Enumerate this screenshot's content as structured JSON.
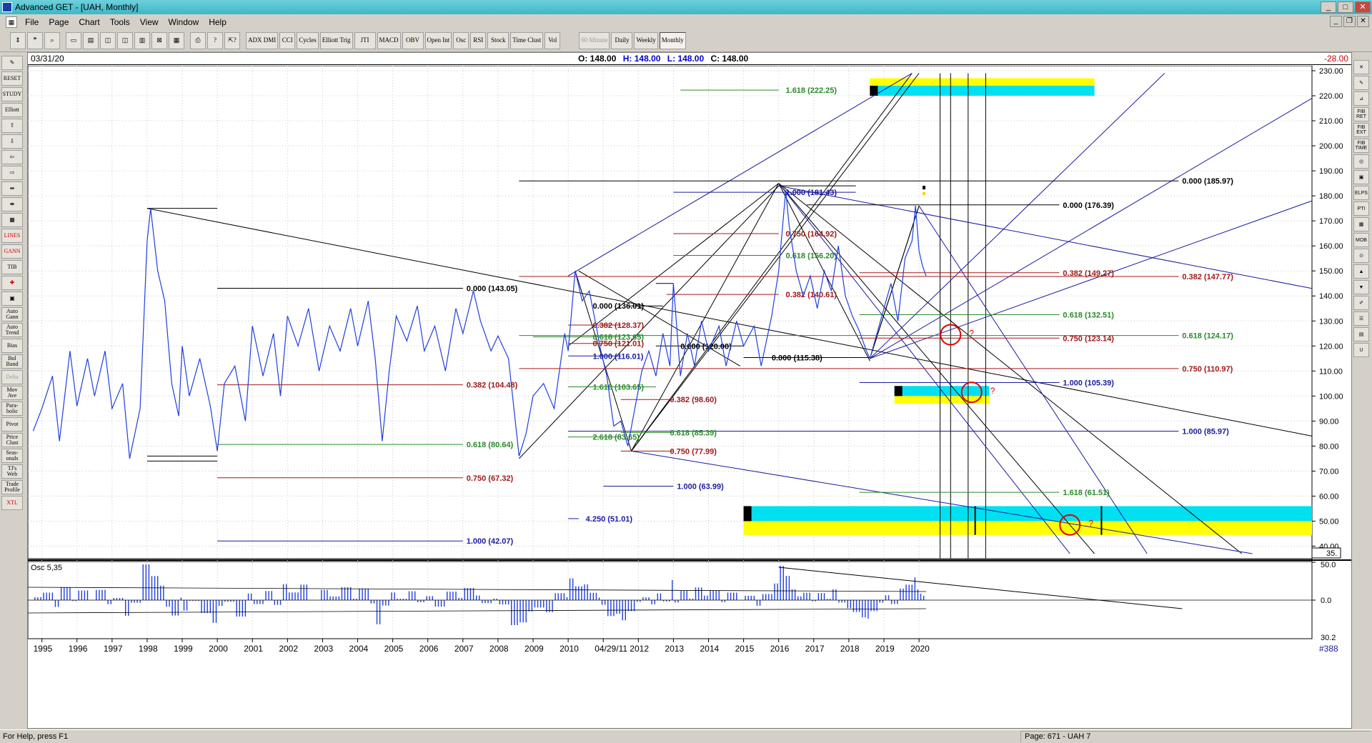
{
  "window": {
    "title": "Advanced GET - [UAH, Monthly]",
    "controls": [
      "_",
      "□",
      "✕"
    ]
  },
  "menu": {
    "items": [
      "File",
      "Page",
      "Chart",
      "Tools",
      "View",
      "Window",
      "Help"
    ]
  },
  "toolbar": {
    "buttons": [
      "ADX DMI",
      "CCI",
      "Cycles",
      "Elliott Trig",
      "JTI",
      "MACD",
      "OBV",
      "Open Int",
      "Osc",
      "RSI",
      "Stock",
      "Time Clust",
      "Vol"
    ],
    "periods": [
      "60 Minute",
      "Daily",
      "Weekly",
      "Monthly"
    ],
    "active_period": "Monthly"
  },
  "left_tools": [
    "RESET",
    "STUDY",
    "Elliott",
    "LINES",
    "GANN",
    "TIB",
    "Auto Gann",
    "Auto Trend",
    "Bias",
    "Bol Band",
    "Delta",
    "Mov Ave",
    "Para-bolic",
    "Pivot",
    "Price Clust",
    "Seas-onals",
    "TJ's Web",
    "Trade Profile",
    "XTL"
  ],
  "right_tools": [
    "FIB RET",
    "FIB EXT",
    "FIB TIME",
    "ELPS",
    "PTI",
    "MOB"
  ],
  "info": {
    "date": "03/31/20",
    "open": "O: 148.00",
    "high": "H: 148.00",
    "low": "L: 148.00",
    "close": "C: 148.00",
    "value": "-28.00"
  },
  "chart_data": {
    "type": "line",
    "symbol": "UAH",
    "timeframe": "Monthly",
    "x_labels": [
      "1995",
      "1996",
      "1997",
      "1998",
      "1999",
      "2000",
      "2001",
      "2002",
      "2003",
      "2004",
      "2005",
      "2006",
      "2007",
      "2008",
      "2009",
      "2010",
      "04/29/11",
      "2012",
      "2013",
      "2014",
      "2015",
      "2016",
      "2017",
      "2018",
      "2019",
      "2020"
    ],
    "y_ticks": [
      40,
      50,
      60,
      70,
      80,
      90,
      100,
      110,
      120,
      130,
      140,
      150,
      160,
      170,
      180,
      190,
      200,
      210,
      220,
      230
    ],
    "y_range": [
      35,
      232
    ],
    "series": [
      {
        "color": "#1f3fe0",
        "points": [
          [
            1994.75,
            86
          ],
          [
            1995.0,
            95
          ],
          [
            1995.3,
            108
          ],
          [
            1995.5,
            82
          ],
          [
            1995.8,
            118
          ],
          [
            1996.0,
            96
          ],
          [
            1996.3,
            115
          ],
          [
            1996.5,
            100
          ],
          [
            1996.8,
            118
          ],
          [
            1997.0,
            95
          ],
          [
            1997.3,
            105
          ],
          [
            1997.5,
            75
          ],
          [
            1997.8,
            95
          ],
          [
            1998.0,
            162
          ],
          [
            1998.1,
            175
          ],
          [
            1998.3,
            150
          ],
          [
            1998.5,
            138
          ],
          [
            1998.7,
            105
          ],
          [
            1998.9,
            92
          ],
          [
            1999.0,
            120
          ],
          [
            1999.2,
            100
          ],
          [
            1999.5,
            115
          ],
          [
            1999.8,
            96
          ],
          [
            2000.0,
            78
          ],
          [
            2000.2,
            105
          ],
          [
            2000.5,
            112
          ],
          [
            2000.8,
            90
          ],
          [
            2001.0,
            128
          ],
          [
            2001.3,
            108
          ],
          [
            2001.6,
            125
          ],
          [
            2001.8,
            100
          ],
          [
            2002.0,
            132
          ],
          [
            2002.3,
            120
          ],
          [
            2002.6,
            135
          ],
          [
            2002.9,
            110
          ],
          [
            2003.2,
            128
          ],
          [
            2003.5,
            118
          ],
          [
            2003.8,
            135
          ],
          [
            2004.0,
            120
          ],
          [
            2004.3,
            138
          ],
          [
            2004.5,
            115
          ],
          [
            2004.7,
            82
          ],
          [
            2004.9,
            110
          ],
          [
            2005.1,
            132
          ],
          [
            2005.4,
            122
          ],
          [
            2005.7,
            136
          ],
          [
            2005.9,
            118
          ],
          [
            2006.2,
            128
          ],
          [
            2006.5,
            110
          ],
          [
            2006.8,
            135
          ],
          [
            2007.0,
            125
          ],
          [
            2007.3,
            142
          ],
          [
            2007.5,
            130
          ],
          [
            2007.8,
            118
          ],
          [
            2008.0,
            124
          ],
          [
            2008.3,
            115
          ],
          [
            2008.6,
            76
          ],
          [
            2008.8,
            85
          ],
          [
            2009.0,
            100
          ],
          [
            2009.3,
            105
          ],
          [
            2009.6,
            95
          ],
          [
            2009.9,
            125
          ],
          [
            2010.0,
            118
          ],
          [
            2010.2,
            150
          ],
          [
            2010.4,
            138
          ],
          [
            2010.6,
            142
          ],
          [
            2010.8,
            128
          ],
          [
            2010.9,
            120
          ],
          [
            2011.1,
            108
          ],
          [
            2011.3,
            88
          ],
          [
            2011.5,
            90
          ],
          [
            2011.7,
            80
          ],
          [
            2011.9,
            95
          ],
          [
            2012.1,
            110
          ],
          [
            2012.3,
            118
          ],
          [
            2012.5,
            108
          ],
          [
            2012.7,
            125
          ],
          [
            2012.9,
            112
          ],
          [
            2013.0,
            145
          ],
          [
            2013.2,
            108
          ],
          [
            2013.4,
            125
          ],
          [
            2013.6,
            112
          ],
          [
            2013.8,
            130
          ],
          [
            2014.0,
            118
          ],
          [
            2014.3,
            128
          ],
          [
            2014.5,
            112
          ],
          [
            2014.8,
            130
          ],
          [
            2015.0,
            120
          ],
          [
            2015.3,
            128
          ],
          [
            2015.5,
            112
          ],
          [
            2015.8,
            132
          ],
          [
            2016.0,
            150
          ],
          [
            2016.2,
            182
          ],
          [
            2016.3,
            168
          ],
          [
            2016.5,
            150
          ],
          [
            2016.7,
            140
          ],
          [
            2016.9,
            148
          ],
          [
            2017.1,
            135
          ],
          [
            2017.3,
            150
          ],
          [
            2017.5,
            142
          ],
          [
            2017.7,
            160
          ],
          [
            2017.9,
            140
          ],
          [
            2018.1,
            132
          ],
          [
            2018.3,
            126
          ],
          [
            2018.5,
            118
          ],
          [
            2018.6,
            115
          ],
          [
            2018.8,
            125
          ],
          [
            2019.0,
            135
          ],
          [
            2019.2,
            145
          ],
          [
            2019.4,
            130
          ],
          [
            2019.6,
            155
          ],
          [
            2019.8,
            162
          ],
          [
            2019.9,
            176
          ],
          [
            2020.0,
            158
          ],
          [
            2020.1,
            152
          ],
          [
            2020.2,
            148
          ]
        ]
      }
    ],
    "annotations": [
      {
        "text": "1.618 (222.25)",
        "color": "#2a8a2a"
      },
      {
        "text": "0.000 (185.97)",
        "color": "#000000"
      },
      {
        "text": "1.000 (181.43)",
        "color": "#1a1aa0"
      },
      {
        "text": "0.000 (176.39)",
        "color": "#000000"
      },
      {
        "text": "0.750 (164.92)",
        "color": "#a01818"
      },
      {
        "text": "0.618 (156.20)",
        "color": "#2a8a2a"
      },
      {
        "text": "0.382 (149.27)",
        "color": "#a01818"
      },
      {
        "text": "0.382 (147.77)",
        "color": "#a01818"
      },
      {
        "text": "0.000 (143.05)",
        "color": "#000000"
      },
      {
        "text": "0.382 (140.61)",
        "color": "#a01818"
      },
      {
        "text": "0.000 (136.01)",
        "color": "#000000"
      },
      {
        "text": "0.618 (132.51)",
        "color": "#2a8a2a"
      },
      {
        "text": "0.382 (128.37)",
        "color": "#a01818"
      },
      {
        "text": "0.618 (124.17)",
        "color": "#2a8a2a"
      },
      {
        "text": "0.618 (123.65)",
        "color": "#2a8a2a"
      },
      {
        "text": "0.750 (123.14)",
        "color": "#a01818"
      },
      {
        "text": "0.750 (121.01)",
        "color": "#a01818"
      },
      {
        "text": "0.000 (120.00)",
        "color": "#000000"
      },
      {
        "text": "1.000 (116.01)",
        "color": "#1a1aa0"
      },
      {
        "text": "0.000 (115.38)",
        "color": "#000000"
      },
      {
        "text": "0.750 (110.97)",
        "color": "#a01818"
      },
      {
        "text": "1.000 (105.39)",
        "color": "#1a1aa0"
      },
      {
        "text": "0.382 (104.48)",
        "color": "#a01818"
      },
      {
        "text": "1.618 (103.65)",
        "color": "#2a8a2a"
      },
      {
        "text": "0.382 (98.60)",
        "color": "#a01818"
      },
      {
        "text": "1.000 (85.97)",
        "color": "#1a1aa0"
      },
      {
        "text": "0.618 (85.39)",
        "color": "#2a8a2a"
      },
      {
        "text": "2.618 (83.65)",
        "color": "#2a8a2a"
      },
      {
        "text": "0.618 (80.64)",
        "color": "#2a8a2a"
      },
      {
        "text": "0.750 (77.99)",
        "color": "#a01818"
      },
      {
        "text": "0.750 (67.32)",
        "color": "#a01818"
      },
      {
        "text": "1.000 (63.99)",
        "color": "#1a1aa0"
      },
      {
        "text": "1.618 (61.51)",
        "color": "#2a8a2a"
      },
      {
        "text": "4.250 (51.01)",
        "color": "#1a1aa0"
      },
      {
        "text": "1.000 (42.07)",
        "color": "#1a1aa0"
      }
    ],
    "last_value_box": "35.",
    "oscillator": {
      "label": "Osc 5,35",
      "ticks": [
        "50.0",
        "0.0",
        "30.2"
      ],
      "color": "#1f3fe0"
    }
  },
  "bottom_right_label": "#388",
  "status": {
    "help": "For Help, press F1",
    "page": "Page: 671 - UAH 7"
  }
}
